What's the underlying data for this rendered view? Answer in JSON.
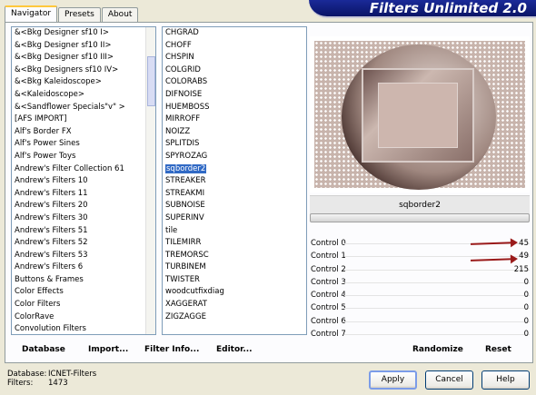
{
  "tabs": [
    "Navigator",
    "Presets",
    "About"
  ],
  "app_title": "Filters Unlimited 2.0",
  "categories": [
    "&<Bkg Designer sf10 I>",
    "&<Bkg Designer sf10 II>",
    "&<Bkg Designer sf10 III>",
    "&<Bkg Designers sf10 IV>",
    "&<Bkg Kaleidoscope>",
    "&<Kaleidoscope>",
    "&<Sandflower Specials\"v\" >",
    "[AFS IMPORT]",
    "Alf's Border FX",
    "Alf's Power Sines",
    "Alf's Power Toys",
    "Andrew's Filter Collection 61",
    "Andrew's Filters 10",
    "Andrew's Filters 11",
    "Andrew's Filters 20",
    "Andrew's Filters 30",
    "Andrew's Filters 51",
    "Andrew's Filters 52",
    "Andrew's Filters 53",
    "Andrew's Filters 6",
    "Buttons & Frames",
    "Color Effects",
    "Color Filters",
    "ColorRave",
    "Convolution Filters"
  ],
  "filters": [
    "CHGRAD",
    "CHOFF",
    "CHSPIN",
    "COLGRID",
    "COLORABS",
    "DIFNOISE",
    "HUEMBOSS",
    "MIRROFF",
    "NOIZZ",
    "SPLITDIS",
    "SPYROZAG",
    "sqborder2",
    "STREAKER",
    "STREAKMI",
    "SUBNOISE",
    "SUPERINV",
    "tile",
    "TILEMIRR",
    "TREMORSC",
    "TURBINEM",
    "TWISTER",
    "woodcutfixdiag",
    "XAGGERAT",
    "ZIGZAGGE"
  ],
  "selected_filter": "sqborder2",
  "filter_name": "sqborder2",
  "controls": [
    {
      "label": "Control 0",
      "value": "45"
    },
    {
      "label": "Control 1",
      "value": "49"
    },
    {
      "label": "Control 2",
      "value": "215"
    },
    {
      "label": "Control 3",
      "value": "0"
    },
    {
      "label": "Control 4",
      "value": "0"
    },
    {
      "label": "Control 5",
      "value": "0"
    },
    {
      "label": "Control 6",
      "value": "0"
    },
    {
      "label": "Control 7",
      "value": "0"
    }
  ],
  "toolbar": {
    "database": "Database",
    "import": "Import...",
    "filter_info": "Filter Info...",
    "editor": "Editor...",
    "randomize": "Randomize",
    "reset": "Reset"
  },
  "footer": {
    "database_label": "Database:",
    "database_value": "ICNET-Filters",
    "filters_label": "Filters:",
    "filters_value": "1473"
  },
  "buttons": {
    "apply": "Apply",
    "cancel": "Cancel",
    "help": "Help"
  },
  "colors": {
    "selection": "#316ac5",
    "annotation_arrow": "#9a1a1a",
    "logo_bg": "#0a1466"
  }
}
